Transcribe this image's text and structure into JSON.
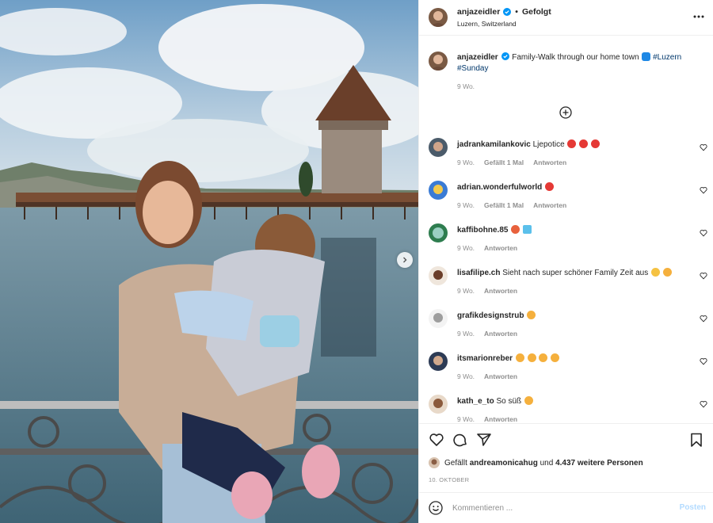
{
  "post": {
    "username": "anjazeidler",
    "follow_status": "Gefolgt",
    "location": "Luzern, Switzerland",
    "more_icon": "more-horizontal-icon"
  },
  "caption": {
    "username": "anjazeidler",
    "text": "Family-Walk through our home town",
    "hashtag_1": "#Luzern",
    "hashtag_2": "#Sunday",
    "time": "9 Wo."
  },
  "comments": [
    {
      "username": "jadrankamilankovic",
      "text": "Ljepotice",
      "time": "9 Wo.",
      "likes": "Gefällt 1 Mal",
      "reply": "Antworten"
    },
    {
      "username": "adrian.wonderfulworld",
      "text": "",
      "time": "9 Wo.",
      "likes": "Gefällt 1 Mal",
      "reply": "Antworten"
    },
    {
      "username": "kaffibohne.85",
      "text": "",
      "time": "9 Wo.",
      "likes": "",
      "reply": "Antworten"
    },
    {
      "username": "lisafilipe.ch",
      "text": "Sieht nach super schöner Family Zeit aus",
      "time": "9 Wo.",
      "likes": "",
      "reply": "Antworten"
    },
    {
      "username": "grafikdesignstrub",
      "text": "",
      "time": "9 Wo.",
      "likes": "",
      "reply": "Antworten"
    },
    {
      "username": "itsmarionreber",
      "text": "",
      "time": "9 Wo.",
      "likes": "",
      "reply": "Antworten"
    },
    {
      "username": "kath_e_to",
      "text": "So süß",
      "time": "9 Wo.",
      "likes": "",
      "reply": "Antworten"
    }
  ],
  "likes": {
    "prefix": "Gefällt",
    "user": "andreamonicahug",
    "middle": "und",
    "count": "4.437 weitere Personen"
  },
  "date": "10. OKTOBER",
  "add_comment": {
    "placeholder": "Kommentieren ...",
    "post_label": "Posten"
  },
  "colors": {
    "link": "#00376b",
    "muted": "#8e8e8e",
    "verified": "#0095f6",
    "post_disabled": "#b3dbff"
  }
}
